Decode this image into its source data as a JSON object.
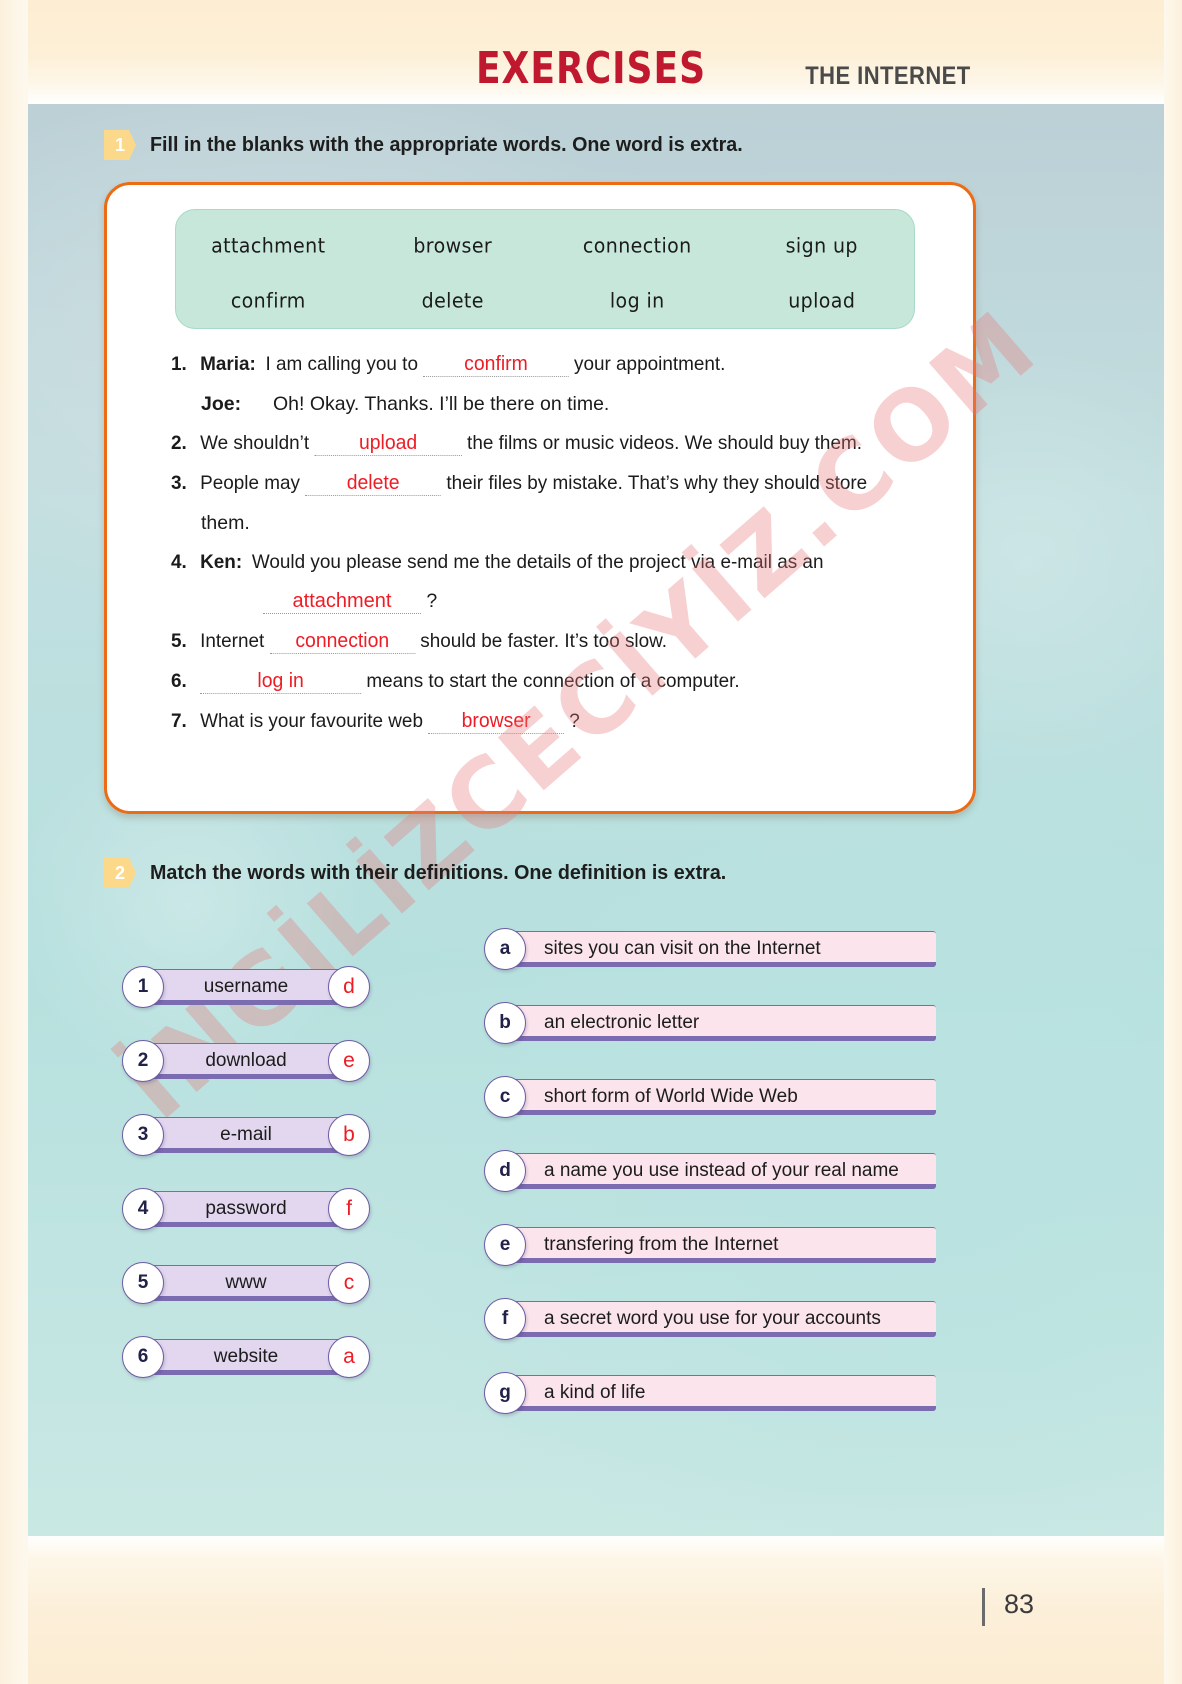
{
  "header": {
    "title": "EXERCISES",
    "subtitle": "THE INTERNET",
    "title_color": "#c0182f"
  },
  "watermark": {
    "text": "İNGİLİZCECİYİZ.COM"
  },
  "footer": {
    "page_number": "83"
  },
  "exercise1": {
    "number": "1",
    "instruction": "Fill in the blanks with the appropriate words. One word is extra.",
    "wordbank": {
      "row1": [
        "attachment",
        "browser",
        "connection",
        "sign up"
      ],
      "row2": [
        "confirm",
        "delete",
        "log in",
        "upload"
      ]
    },
    "items": [
      {
        "num": "1.",
        "speaker": "Maria:",
        "before": "I am calling you to",
        "answer": "confirm",
        "after": "your appointment.",
        "reply_speaker": "Joe:",
        "reply_text": "Oh! Okay. Thanks. I’ll be there on time."
      },
      {
        "num": "2.",
        "before": "We shouldn’t",
        "answer": "upload",
        "after": "the films or music videos. We should buy them."
      },
      {
        "num": "3.",
        "before": "People may",
        "answer": "delete",
        "after": "their files by mistake. That’s why they should store",
        "continuation": "them."
      },
      {
        "num": "4.",
        "speaker": "Ken:",
        "before": "Would you please send me the details of the project via e-mail as an",
        "answer": "attachment",
        "after": "?"
      },
      {
        "num": "5.",
        "before": "Internet",
        "answer": "connection",
        "after": "should be faster. It’s too slow."
      },
      {
        "num": "6.",
        "before": "",
        "answer": "log in",
        "after": "means to start the connection of a computer."
      },
      {
        "num": "7.",
        "before": "What is your favourite web",
        "answer": "browser",
        "after": "?"
      }
    ]
  },
  "exercise2": {
    "number": "2",
    "instruction": "Match the words with their definitions. One definition is extra.",
    "words": [
      {
        "num": "1",
        "label": "username",
        "answer": "d"
      },
      {
        "num": "2",
        "label": "download",
        "answer": "e"
      },
      {
        "num": "3",
        "label": "e-mail",
        "answer": "b"
      },
      {
        "num": "4",
        "label": "password",
        "answer": "f"
      },
      {
        "num": "5",
        "label": "www",
        "answer": "c"
      },
      {
        "num": "6",
        "label": "website",
        "answer": "a"
      }
    ],
    "definitions": [
      {
        "letter": "a",
        "text": "sites you can visit on the Internet"
      },
      {
        "letter": "b",
        "text": "an electronic letter"
      },
      {
        "letter": "c",
        "text": "short form of World Wide Web"
      },
      {
        "letter": "d",
        "text": "a name you use instead of your real name"
      },
      {
        "letter": "e",
        "text": "transfering  from the Internet"
      },
      {
        "letter": "f",
        "text": "a secret word you use for your accounts"
      },
      {
        "letter": "g",
        "text": "a kind of life"
      }
    ]
  }
}
